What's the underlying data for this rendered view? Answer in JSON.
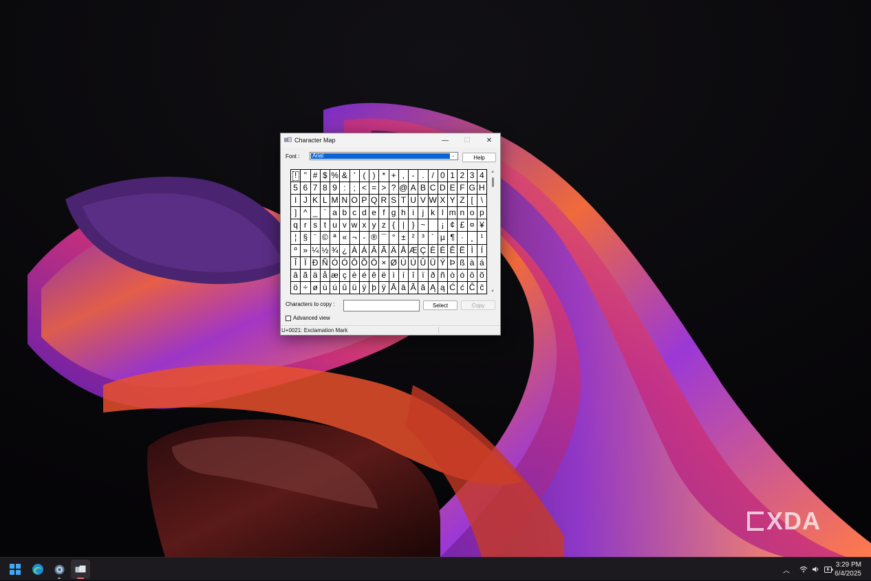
{
  "window": {
    "title": "Character Map",
    "minimize_glyph": "—",
    "maximize_glyph": "☐",
    "close_glyph": "✕"
  },
  "font": {
    "label": "Font :",
    "selected": "Arial",
    "dropdown_glyph": "⌄"
  },
  "buttons": {
    "help": "Help",
    "select": "Select",
    "copy": "Copy"
  },
  "grid": {
    "selected_char": "!",
    "rows": [
      [
        "!",
        "\"",
        "#",
        "$",
        "%",
        "&",
        "'",
        "(",
        ")",
        "*",
        "+",
        ",",
        "-",
        ".",
        "/",
        "0",
        "1",
        "2",
        "3",
        "4"
      ],
      [
        "5",
        "6",
        "7",
        "8",
        "9",
        ":",
        ";",
        "<",
        "=",
        ">",
        "?",
        "@",
        "A",
        "B",
        "C",
        "D",
        "E",
        "F",
        "G",
        "H"
      ],
      [
        "I",
        "J",
        "K",
        "L",
        "M",
        "N",
        "O",
        "P",
        "Q",
        "R",
        "S",
        "T",
        "U",
        "V",
        "W",
        "X",
        "Y",
        "Z",
        "[",
        "\\"
      ],
      [
        "]",
        "^",
        "_",
        "`",
        "a",
        "b",
        "c",
        "d",
        "e",
        "f",
        "g",
        "h",
        "i",
        "j",
        "k",
        "l",
        "m",
        "n",
        "o",
        "p"
      ],
      [
        "q",
        "r",
        "s",
        "t",
        "u",
        "v",
        "w",
        "x",
        "y",
        "z",
        "{",
        "|",
        "}",
        "~",
        " ",
        "¡",
        "¢",
        "£",
        "¤",
        "¥"
      ],
      [
        "¦",
        "§",
        "¨",
        "©",
        "ª",
        "«",
        "¬",
        "-",
        "®",
        "¯",
        "°",
        "±",
        "²",
        "³",
        "´",
        "µ",
        "¶",
        "·",
        "¸",
        "¹"
      ],
      [
        "º",
        "»",
        "¼",
        "½",
        "¾",
        "¿",
        "À",
        "Á",
        "Â",
        "Ã",
        "Ä",
        "Å",
        "Æ",
        "Ç",
        "È",
        "É",
        "Ê",
        "Ë",
        "Ì",
        "Í"
      ],
      [
        "Î",
        "Ï",
        "Ð",
        "Ñ",
        "Ò",
        "Ó",
        "Ô",
        "Õ",
        "Ö",
        "×",
        "Ø",
        "Ù",
        "Ú",
        "Û",
        "Ü",
        "Ý",
        "Þ",
        "ß",
        "à",
        "á"
      ],
      [
        "â",
        "ã",
        "ä",
        "å",
        "æ",
        "ç",
        "è",
        "é",
        "ê",
        "ë",
        "ì",
        "í",
        "î",
        "ï",
        "ð",
        "ñ",
        "ò",
        "ó",
        "ô",
        "õ"
      ],
      [
        "ö",
        "÷",
        "ø",
        "ù",
        "ú",
        "û",
        "ü",
        "ý",
        "þ",
        "ÿ",
        "Ā",
        "ā",
        "Ă",
        "ă",
        "Ą",
        "ą",
        "Ć",
        "ć",
        "Ĉ",
        "ĉ"
      ]
    ]
  },
  "copy": {
    "label": "Characters to copy :",
    "value": ""
  },
  "advanced_view": {
    "label": "Advanced view",
    "checked": false
  },
  "status": "U+0021: Exclamation Mark",
  "taskbar": {
    "clock_time": "3:29 PM",
    "clock_date": "6/4/2025",
    "apps": [
      "start-icon",
      "browser-icon",
      "settings-icon",
      "character-map-icon"
    ],
    "tray_icons": [
      "chevron-up-icon",
      "wifi-icon",
      "volume-icon",
      "battery-icon"
    ]
  },
  "watermark": "XDA",
  "colors": {
    "selection": "#0a64d6",
    "accent": "#3fa9f5"
  }
}
